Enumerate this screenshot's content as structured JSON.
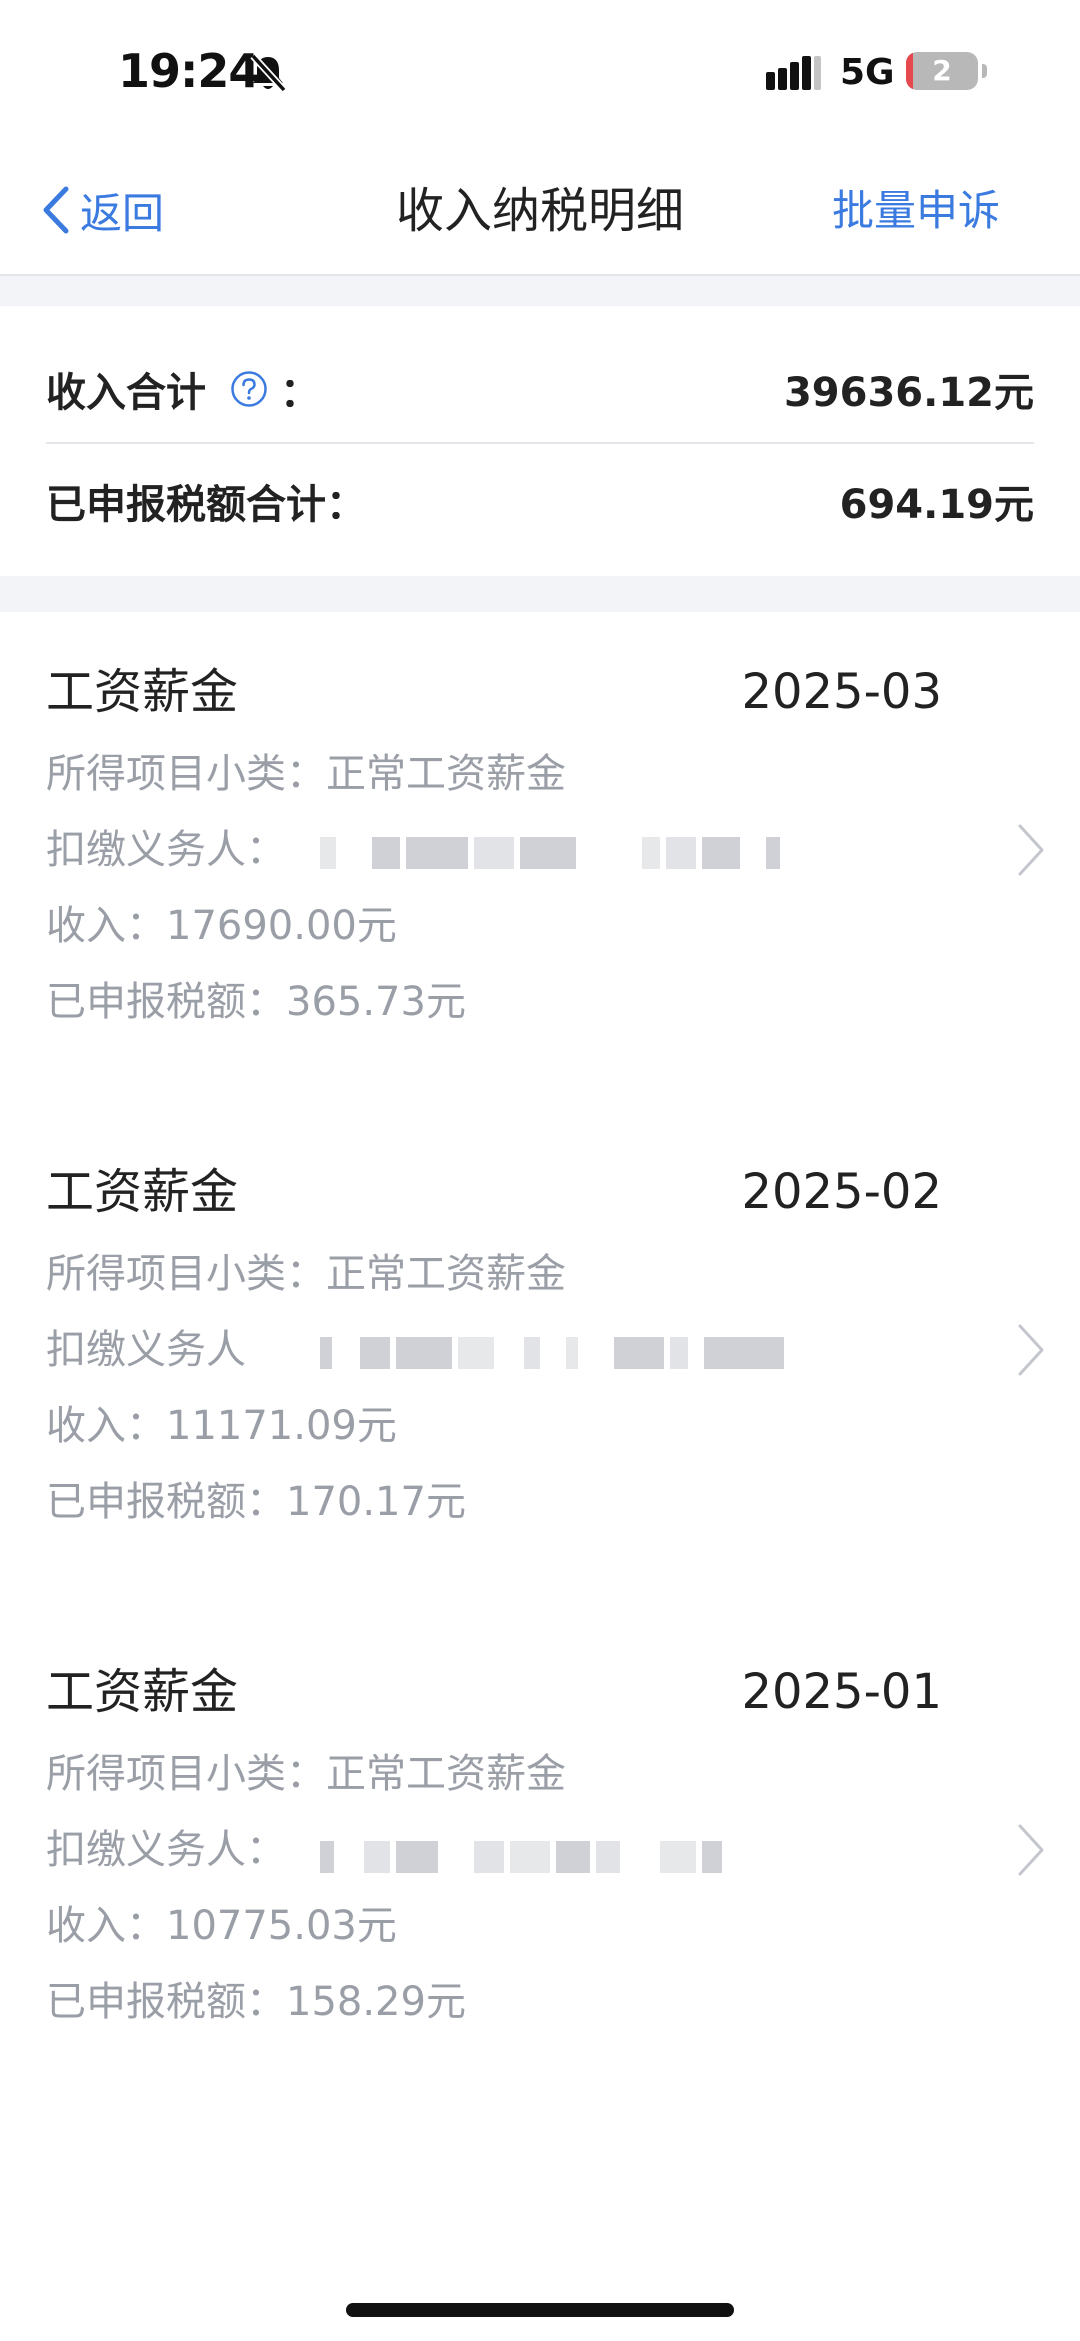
{
  "status_bar": {
    "time": "19:24",
    "network": "5G",
    "battery_level": "2",
    "battery_fraction": 0.1,
    "mute_icon": "bell-slash-icon",
    "signal_icon": "signal-bars-icon"
  },
  "nav": {
    "back_label": "返回",
    "title": "收入纳税明细",
    "batch_label": "批量申诉"
  },
  "summary": {
    "income_label": "收入合计",
    "income_colon": "：",
    "income_value": "39636.12元",
    "tax_label": "已申报税额合计：",
    "tax_value": "694.19元"
  },
  "records": [
    {
      "title": "工资薪金",
      "date": "2025-03",
      "subcategory": "所得项目小类：正常工资薪金",
      "withholder_label": "扣缴义务人：",
      "income": "收入：17690.00元",
      "tax": "已申报税额：365.73元"
    },
    {
      "title": "工资薪金",
      "date": "2025-02",
      "subcategory": "所得项目小类：正常工资薪金",
      "withholder_label": "扣缴义务人",
      "income": "收入：11171.09元",
      "tax": "已申报税额：170.17元"
    },
    {
      "title": "工资薪金",
      "date": "2025-01",
      "subcategory": "所得项目小类：正常工资薪金",
      "withholder_label": "扣缴义务人：",
      "income": "收入：10775.03元",
      "tax": "已申报税额：158.29元"
    }
  ],
  "colors": {
    "accent": "#3b7be0",
    "secondary_text": "#9a9ea6",
    "separator": "#f2f4f7"
  }
}
